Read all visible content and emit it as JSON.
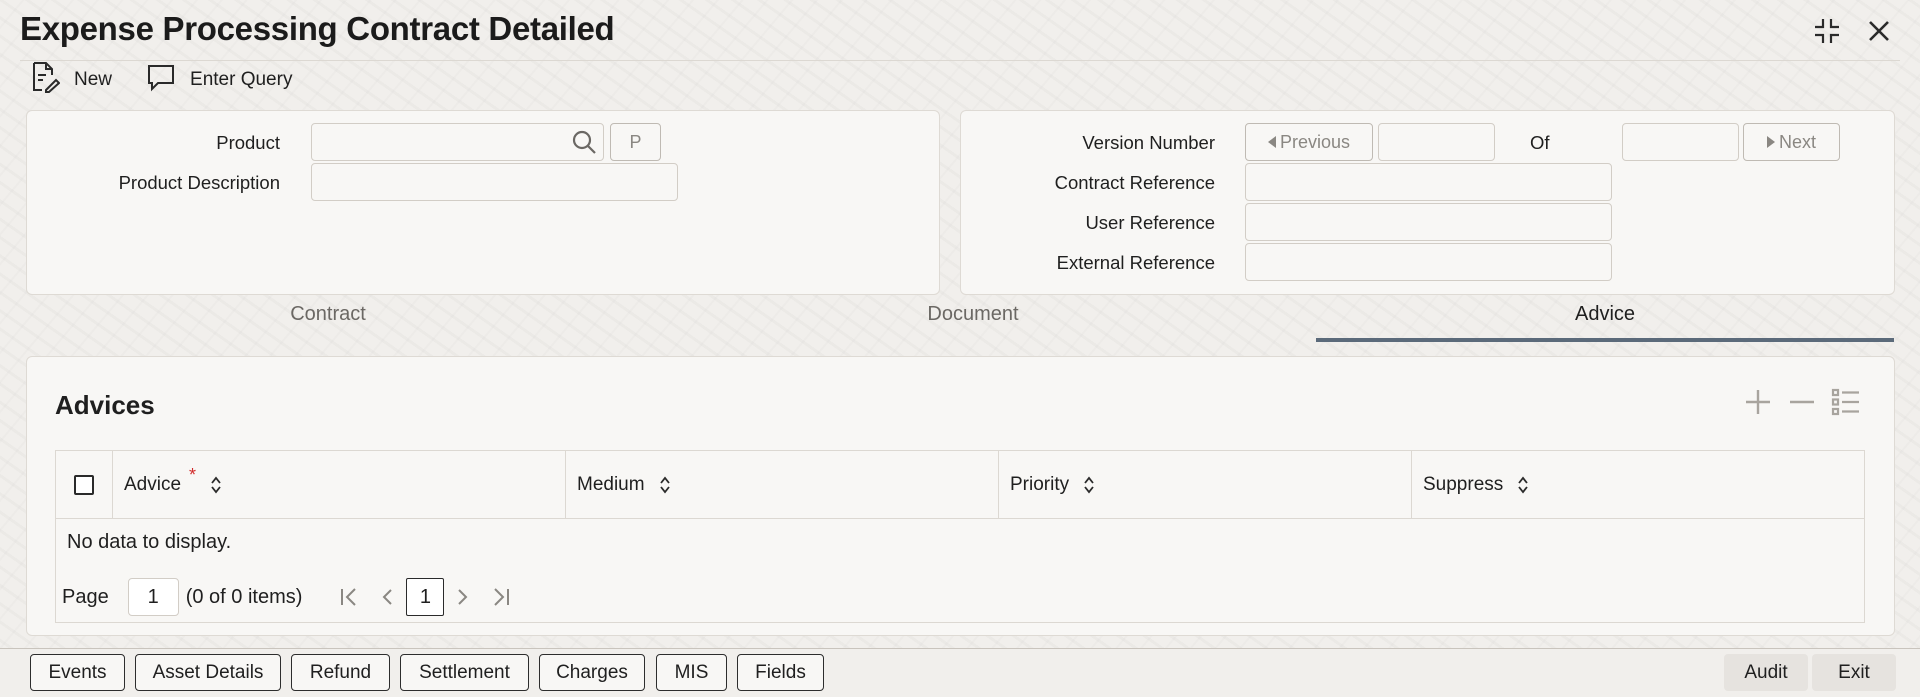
{
  "window": {
    "title": "Expense Processing Contract Detailed"
  },
  "toolbar": {
    "new_label": "New",
    "enter_query_label": "Enter Query"
  },
  "product_section": {
    "product_label": "Product",
    "product_value": "",
    "product_button_label": "P",
    "product_description_label": "Product Description",
    "product_description_value": ""
  },
  "version_section": {
    "version_number_label": "Version Number",
    "previous_label": "Previous",
    "version_value": "",
    "of_label": "Of",
    "of_value": "",
    "next_label": "Next",
    "contract_reference_label": "Contract Reference",
    "contract_reference_value": "",
    "user_reference_label": "User Reference",
    "user_reference_value": "",
    "external_reference_label": "External Reference",
    "external_reference_value": ""
  },
  "tabs": [
    {
      "label": "Contract",
      "active": false
    },
    {
      "label": "Document",
      "active": false
    },
    {
      "label": "Advice",
      "active": true
    }
  ],
  "advices": {
    "title": "Advices",
    "columns": [
      {
        "label": "Advice",
        "required": true
      },
      {
        "label": "Medium",
        "required": false
      },
      {
        "label": "Priority",
        "required": false
      },
      {
        "label": "Suppress",
        "required": false
      }
    ],
    "required_marker": "*",
    "empty_text": "No data to display.",
    "pager": {
      "page_label": "Page",
      "page_value": "1",
      "items_text": "(0 of 0 items)",
      "current_page": "1"
    }
  },
  "footer": {
    "buttons": [
      "Events",
      "Asset Details",
      "Refund",
      "Settlement",
      "Charges",
      "MIS",
      "Fields"
    ],
    "audit_label": "Audit",
    "exit_label": "Exit"
  },
  "colors": {
    "accent": "#5b6a7a",
    "required": "#d12b2b",
    "background": "#f1efec",
    "panel": "#f8f7f5"
  }
}
